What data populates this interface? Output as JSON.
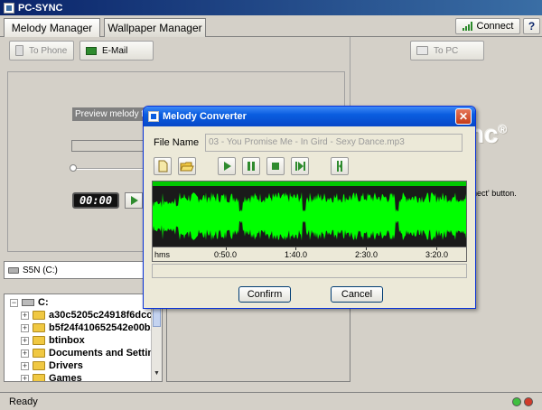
{
  "app": {
    "title": "PC-SYNC"
  },
  "tabs": [
    {
      "label": "Melody Manager"
    },
    {
      "label": "Wallpaper Manager"
    }
  ],
  "header": {
    "connect_label": "Connect",
    "help_label": "?"
  },
  "left_toolbar": {
    "to_phone": "To Phone",
    "email": "E-Mail"
  },
  "right_toolbar": {
    "to_pc": "To PC"
  },
  "preview": {
    "label": "Preview melody fil",
    "time": "00:00"
  },
  "right_panel": {
    "brand": "nc",
    "brand_mark": "®",
    "text1": "s",
    "text2": "nect' button."
  },
  "drive": {
    "label": "S5N (C:)"
  },
  "tree": {
    "root": "C:",
    "items": [
      {
        "name": "a30c5205c24918f6dcc6"
      },
      {
        "name": "b5f24f410652542e00b2"
      },
      {
        "name": "btinbox"
      },
      {
        "name": "Documents and Settings"
      },
      {
        "name": "Drivers"
      },
      {
        "name": "Games"
      }
    ]
  },
  "status": {
    "text": "Ready"
  },
  "dialog": {
    "title": "Melody Converter",
    "close": "✕",
    "file_name_label": "File Name",
    "file_name_value": "03 - You Promise Me - In Gird - Sexy Dance.mp3",
    "timeline": {
      "unit": "hms",
      "ticks": [
        "0:50.0",
        "1:40.0",
        "2:30.0",
        "3:20.0"
      ]
    },
    "confirm": "Confirm",
    "cancel": "Cancel"
  },
  "colors": {
    "waveform": "#00ff00",
    "wave_bg": "#1a1a1a",
    "title_blue": "#0a5ee0"
  }
}
